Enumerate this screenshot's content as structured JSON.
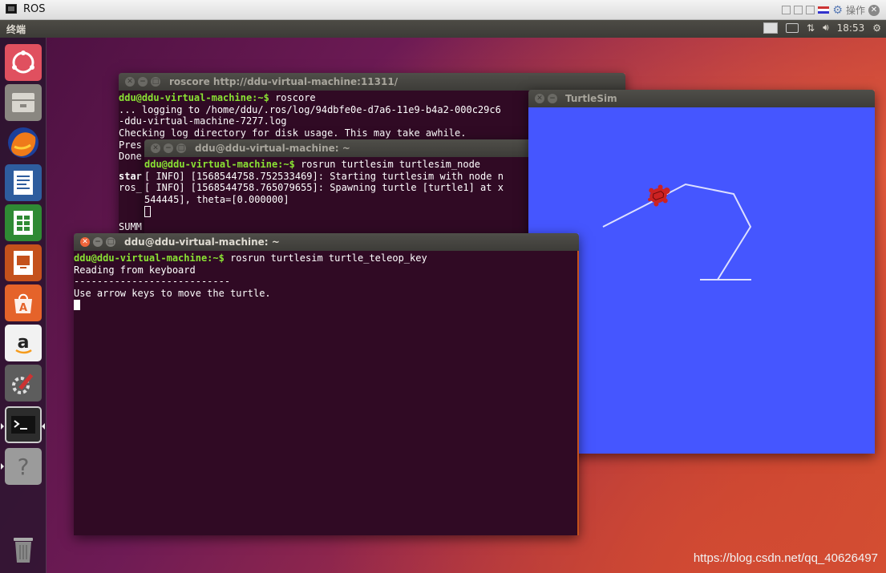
{
  "vm": {
    "title": "ROS",
    "ops_label": "操作"
  },
  "panel": {
    "app_name": "终端",
    "time": "18:53"
  },
  "launcher": {
    "items": [
      "ubuntu-dash",
      "files",
      "firefox",
      "libreoffice-writer",
      "libreoffice-calc",
      "libreoffice-impress",
      "ubuntu-software",
      "amazon",
      "system-settings",
      "terminal",
      "help"
    ],
    "trash": "trash"
  },
  "windows": {
    "roscore": {
      "title": "roscore http://ddu-virtual-machine:11311/",
      "prompt": "ddu@ddu-virtual-machine:~$",
      "command": " roscore",
      "lines": [
        "... logging to /home/ddu/.ros/log/94dbfe0e-d7a6-11e9-b4a2-000c29c6",
        "-ddu-virtual-machine-7277.log",
        "Checking log directory for disk usage. This may take awhile.",
        "Pres",
        "Done",
        "",
        "star",
        "ros_",
        "",
        "",
        "SUMM"
      ]
    },
    "turtlesim_node": {
      "title": "ddu@ddu-virtual-machine: ~",
      "prompt": "ddu@ddu-virtual-machine:~$",
      "command": " rosrun turtlesim turtlesim_node",
      "lines": [
        "[ INFO] [1568544758.752533469]: Starting turtlesim with node n",
        "[ INFO] [1568544758.765079655]: Spawning turtle [turtle1] at x",
        "544445], theta=[0.000000]"
      ]
    },
    "teleop": {
      "title": "ddu@ddu-virtual-machine: ~",
      "prompt": "ddu@ddu-virtual-machine:~$",
      "command": " rosrun turtlesim turtle_teleop_key",
      "lines": [
        "Reading from keyboard",
        "---------------------------",
        "Use arrow keys to move the turtle."
      ]
    },
    "turtlesim": {
      "title": "TurtleSim",
      "background": "#4556ff",
      "path_color": "#dde0ff",
      "turtle_color": "#cc2222"
    }
  },
  "watermark": "https://blog.csdn.net/qq_40626497"
}
